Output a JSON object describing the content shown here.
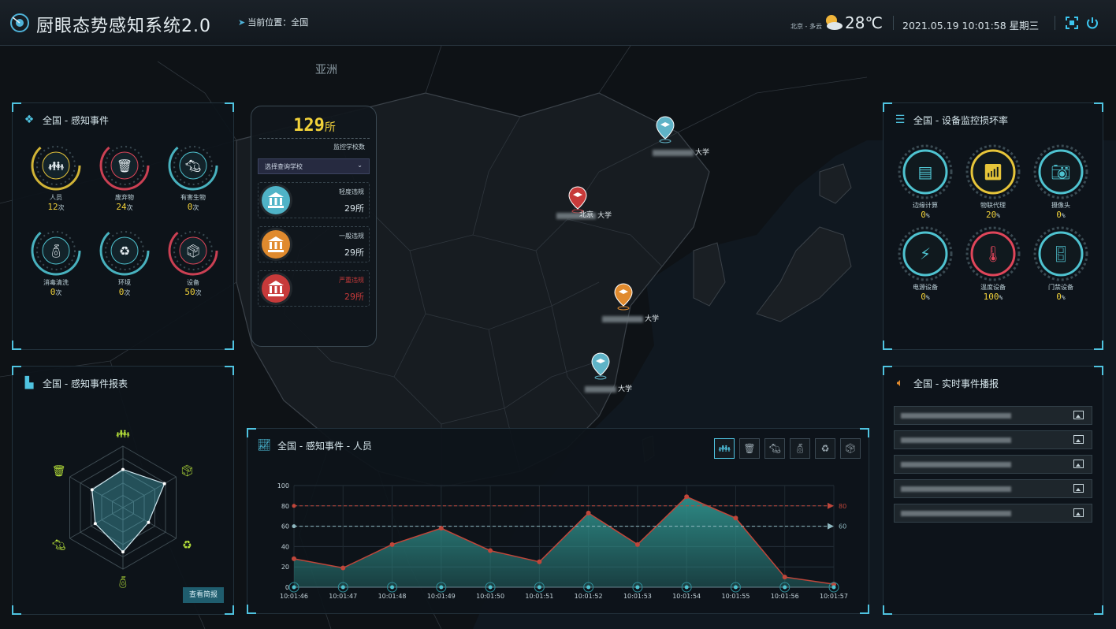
{
  "header": {
    "title": "厨眼态势感知系统2.0",
    "location_label": "当前位置：全国",
    "weather_city": "北京 - 多云",
    "temperature": "28℃",
    "datetime": "2021.05.19 10:01:58 星期三",
    "icons": [
      "fullscreen-icon",
      "power-icon"
    ]
  },
  "map": {
    "region_label": "亚洲",
    "markers": [
      {
        "color": "#5fb3c7",
        "city": "",
        "label": "大学"
      },
      {
        "color": "#c73a3a",
        "city": "北京",
        "label": "大学"
      },
      {
        "color": "#e08a2e",
        "city": "",
        "label": "大学"
      },
      {
        "color": "#5fb3c7",
        "city": "",
        "label": "大学"
      }
    ]
  },
  "events_panel": {
    "title": "全国 - 感知事件",
    "unit": "次",
    "items": [
      {
        "label": "人员",
        "value": "12",
        "color": "#e6c53a",
        "icon": "people-icon"
      },
      {
        "label": "废弃物",
        "value": "24",
        "color": "#e0465a",
        "icon": "trash-icon"
      },
      {
        "label": "有害生物",
        "value": "0",
        "color": "#4fc3d0",
        "icon": "pest-icon"
      },
      {
        "label": "消毒清洗",
        "value": "0",
        "color": "#4fc3d0",
        "icon": "sanitizer-icon"
      },
      {
        "label": "环境",
        "value": "0",
        "color": "#4fc3d0",
        "icon": "recycle-icon"
      },
      {
        "label": "设备",
        "value": "50",
        "color": "#e0465a",
        "icon": "device-box-icon"
      }
    ]
  },
  "schools": {
    "count": "129",
    "count_unit": "所",
    "count_label": "监控学校数",
    "select_placeholder": "选择查询学校",
    "levels": [
      {
        "label": "轻度违规",
        "value": "29所",
        "color": "#4fb3c7"
      },
      {
        "label": "一般违规",
        "value": "29所",
        "color": "#e08a2e"
      },
      {
        "label": "严重违规",
        "value": "29所",
        "color": "#c73a3a"
      }
    ]
  },
  "report_panel": {
    "title": "全国 - 感知事件报表",
    "button": "查看简报",
    "radar_axes": [
      "people-icon",
      "device-box-icon",
      "recycle-icon",
      "sanitizer-icon",
      "pest-icon",
      "trash-icon"
    ]
  },
  "device_panel": {
    "title": "全国 - 设备监控损坏率",
    "items": [
      {
        "label": "边缘计算",
        "value": "0",
        "unit": "%",
        "color": "#4fc3d0",
        "icon": "server-icon"
      },
      {
        "label": "物联代理",
        "value": "20",
        "unit": "%",
        "color": "#e6c53a",
        "icon": "router-icon"
      },
      {
        "label": "摄像头",
        "value": "0",
        "unit": "%",
        "color": "#4fc3d0",
        "icon": "camera-icon"
      },
      {
        "label": "电源设备",
        "value": "0",
        "unit": "%",
        "color": "#4fc3d0",
        "icon": "power-supply-icon"
      },
      {
        "label": "温度设备",
        "value": "100",
        "unit": "%",
        "color": "#e0465a",
        "icon": "thermometer-icon"
      },
      {
        "label": "门禁设备",
        "value": "0",
        "unit": "%",
        "color": "#4fc3d0",
        "icon": "door-icon"
      }
    ]
  },
  "broadcast_panel": {
    "title": "全国 - 实时事件播报",
    "items": 5
  },
  "chart_panel": {
    "title": "全国 - 感知事件 - 人员",
    "type_buttons": [
      "people-icon",
      "trash-icon",
      "pest-icon",
      "sanitizer-icon",
      "recycle-icon",
      "device-box-icon"
    ]
  },
  "chart_data": {
    "type": "area",
    "x": [
      "10:01:46",
      "10:01:47",
      "10:01:48",
      "10:01:49",
      "10:01:50",
      "10:01:51",
      "10:01:52",
      "10:01:53",
      "10:01:54",
      "10:01:55",
      "10:01:56",
      "10:01:57"
    ],
    "values": [
      28,
      19,
      42,
      58,
      36,
      25,
      73,
      42,
      89,
      68,
      10,
      3
    ],
    "ylim": [
      0,
      100
    ],
    "yticks": [
      0,
      20,
      40,
      60,
      80,
      100
    ],
    "reference_lines": [
      {
        "value": 80,
        "label": "80",
        "color": "#c0463a"
      },
      {
        "value": 60,
        "label": "60",
        "color": "#8fb8c0"
      }
    ],
    "fill_color": "#2f8f8a",
    "line_color": "#c0463a",
    "grid": true
  },
  "radar_data": {
    "values": [
      0.62,
      0.78,
      0.48,
      0.72,
      0.52,
      0.58
    ],
    "levels": 5
  }
}
